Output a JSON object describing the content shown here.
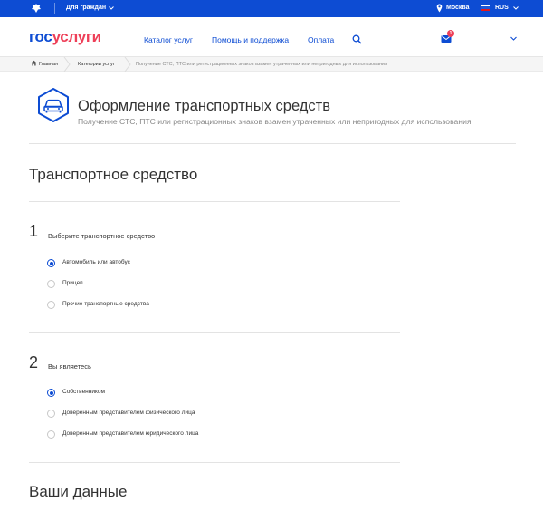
{
  "topbar": {
    "audience": "Для граждан",
    "city": "Москва",
    "language": "RUS"
  },
  "header": {
    "logo_part1": "гос",
    "logo_part2": "услуги",
    "nav": [
      "Каталог услуг",
      "Помощь и поддержка",
      "Оплата"
    ],
    "mail_badge": "1"
  },
  "breadcrumbs": {
    "home": "Главная",
    "category": "Категории услуг",
    "current": "Получение СТС, ПТС или регистрационных знаков взамен утраченных или непригодных для использования"
  },
  "service": {
    "title": "Оформление транспортных средств",
    "subtitle": "Получение СТС, ПТС или регистрационных знаков взамен утраченных или непригодных для использования"
  },
  "sections": {
    "vehicle": "Транспортное средство",
    "your_data": "Ваши данные"
  },
  "step1": {
    "number": "1",
    "label": "Выберите транспортное средство",
    "options": [
      "Автомобиль или автобус",
      "Прицеп",
      "Прочие транспортные средства"
    ],
    "selected": 0
  },
  "step2": {
    "number": "2",
    "label": "Вы являетесь",
    "options": [
      "Собственником",
      "Доверенным представителем физического лица",
      "Доверенным представителем юридического лица"
    ],
    "selected": 0
  },
  "colors": {
    "brand_blue": "#0d4cd3",
    "brand_red": "#ee3f58"
  }
}
